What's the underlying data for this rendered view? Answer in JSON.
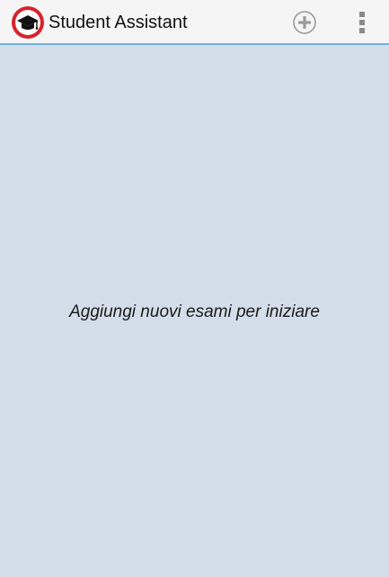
{
  "action_bar": {
    "title": "Student Assistant",
    "app_icon": "graduation-cap-icon",
    "add_icon": "add-circle-icon",
    "overflow_icon": "more-vert-icon",
    "accent_color": "#6fb3e0",
    "icon_ring_color": "#d8232a"
  },
  "main": {
    "empty_message": "Aggiungi nuovi esami per iniziare",
    "background_color": "#d3deea"
  }
}
